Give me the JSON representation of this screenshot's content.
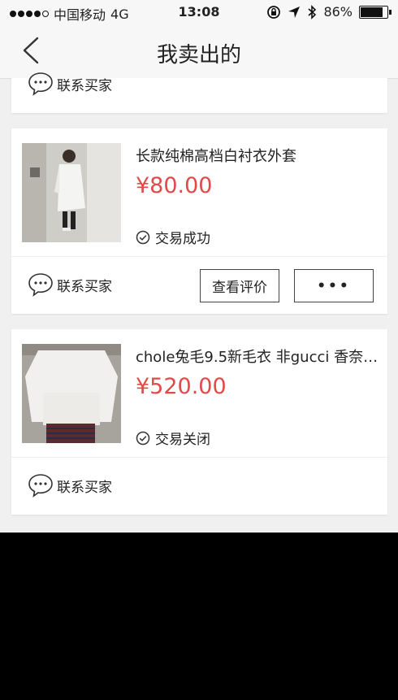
{
  "status_bar": {
    "carrier": "中国移动",
    "network": "4G",
    "time": "13:08",
    "battery": "86%",
    "battery_level": 0.86
  },
  "nav": {
    "title": "我卖出的"
  },
  "orders": [
    {
      "contact_label": "联系买家"
    },
    {
      "product_name": "长款纯棉高档白衬衣外套",
      "price": "¥80.00",
      "status": "交易成功",
      "contact_label": "联系买家",
      "review_label": "查看评价",
      "more_label": "•••"
    },
    {
      "product_name": "chole兔毛9.5新毛衣 非gucci 香奈…",
      "price": "¥520.00",
      "status": "交易关闭",
      "contact_label": "联系买家"
    }
  ]
}
